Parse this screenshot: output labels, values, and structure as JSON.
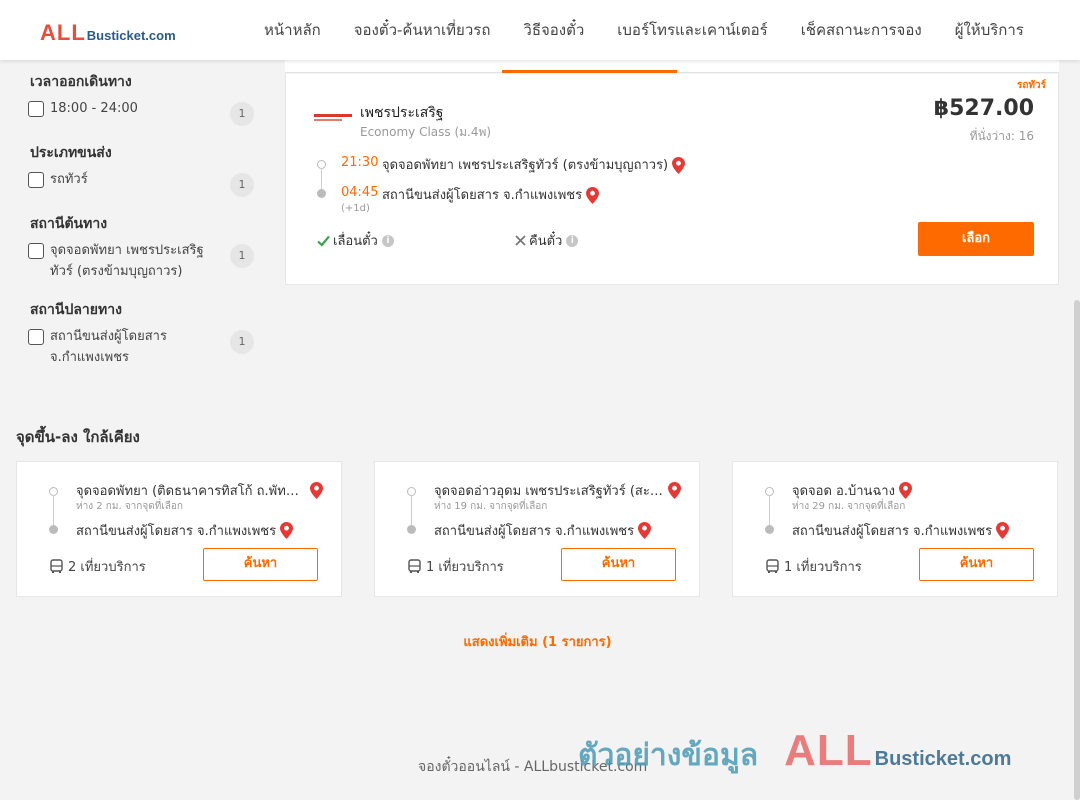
{
  "header": {
    "logo_all": "ALL",
    "logo_rest": "Busticket.com",
    "nav": [
      "หน้าหลัก",
      "จองตั๋ว-ค้นหาเที่ยวรถ",
      "วิธีจองตั๋ว",
      "เบอร์โทรและเคาน์เตอร์",
      "เช็คสถานะการจอง",
      "ผู้ให้บริการ"
    ]
  },
  "filters": {
    "departure_time": {
      "title": "เวลาออกเดินทาง",
      "option": "18:00 - 24:00",
      "count": "1"
    },
    "transport_type": {
      "title": "ประเภทขนส่ง",
      "option": "รถทัวร์",
      "count": "1"
    },
    "origin": {
      "title": "สถานีต้นทาง",
      "option": "จุดจอดพัทยา เพชรประเสริฐทัวร์ (ตรงข้ามบุญถาวร)",
      "count": "1"
    },
    "destination": {
      "title": "สถานีปลายทาง",
      "option": "สถานีขนส่งผู้โดยสาร จ.กำแพงเพชร",
      "count": "1"
    }
  },
  "trip": {
    "tag": "รถทัวร์",
    "operator": "เพชรประเสริฐ",
    "bus_class": "Economy Class (ม.4พ)",
    "price": "฿527.00",
    "seats": "ที่นั่งว่าง: 16",
    "depart_time": "21:30",
    "depart_stop": "จุดจอดพัทยา เพชรประเสริฐทัวร์ (ตรงข้ามบุญถาวร)",
    "arrive_time": "04:45",
    "arrive_stop": "สถานีขนส่งผู้โดยสาร จ.กำแพงเพชร",
    "plus_day": "(+1d)",
    "reschedule": "เลื่อนตั๋ว",
    "refund": "คืนตั๋ว",
    "select_label": "เลือก"
  },
  "nearby": {
    "title": "จุดขึ้น-ลง ใกล้เคียง",
    "cards": [
      {
        "from": "จุดจอดพัทยา (ติดธนาคารทิสโก้ ถ.พัทยากลาง)",
        "distance": "ห่าง 2 กม. จากจุดที่เลือก",
        "to": "สถานีขนส่งผู้โดยสาร จ.กำแพงเพชร",
        "trips": "2 เที่ยวบริการ",
        "button": "ค้นหา"
      },
      {
        "from": "จุดจอดอ่าวอุดม เพชรประเสริฐทัวร์ (สะพานลอย)",
        "distance": "ห่าง 19 กม. จากจุดที่เลือก",
        "to": "สถานีขนส่งผู้โดยสาร จ.กำแพงเพชร",
        "trips": "1 เที่ยวบริการ",
        "button": "ค้นหา"
      },
      {
        "from": "จุดจอด อ.บ้านฉาง",
        "distance": "ห่าง 29 กม. จากจุดที่เลือก",
        "to": "สถานีขนส่งผู้โดยสาร จ.กำแพงเพชร",
        "trips": "1 เที่ยวบริการ",
        "button": "ค้นหา"
      }
    ],
    "show_more": "แสดงเพิ่มเติม (1 รายการ)"
  },
  "footer": {
    "text": "จองตั๋วออนไลน์ - ALLbusticket.com"
  },
  "watermark": {
    "thai": "ตัวอย่างข้อมูล",
    "all": "ALL",
    "rest": "Busticket.com"
  },
  "colors": {
    "accent": "#ff6a00",
    "logo_red": "#e84c3d",
    "logo_blue": "#2a5a8a",
    "pin": "#e53935"
  }
}
